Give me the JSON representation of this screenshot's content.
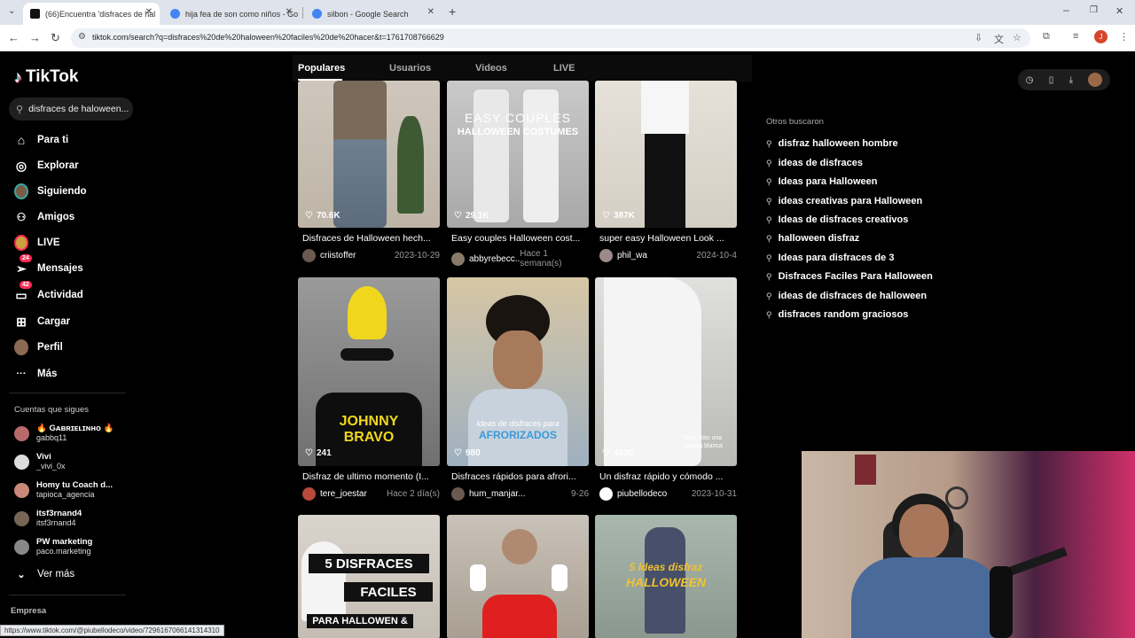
{
  "browser": {
    "tabs": [
      {
        "title": "(66)Encuentra 'disfraces de hal",
        "active": true,
        "favicon_color": "#111111"
      },
      {
        "title": "hija fea de son como niños - Go",
        "active": false,
        "favicon_color": "#4285f4"
      },
      {
        "title": "silbon - Google Search",
        "active": false,
        "favicon_color": "#4285f4"
      }
    ],
    "url": "tiktok.com/search?q=disfraces%20de%20haloween%20faciles%20de%20hacer&t=1761708766629",
    "profile_initial": "J",
    "status_url": "https://www.tiktok.com/@piubellodeco/video/7296167066141314310"
  },
  "tiktok": {
    "logo": "TikTok",
    "search_value": "disfraces de haloween...",
    "nav": [
      {
        "label": "Para ti",
        "icon": "home-icon",
        "glyph": "⌂"
      },
      {
        "label": "Explorar",
        "icon": "compass-icon",
        "glyph": "◎"
      },
      {
        "label": "Siguiendo",
        "icon": "following-avatar-icon",
        "glyph": ""
      },
      {
        "label": "Amigos",
        "icon": "friends-icon",
        "glyph": "👥"
      },
      {
        "label": "LIVE",
        "icon": "live-avatar-icon",
        "glyph": ""
      },
      {
        "label": "Mensajes",
        "icon": "messages-icon",
        "glyph": "✈",
        "badge": "24"
      },
      {
        "label": "Actividad",
        "icon": "activity-icon",
        "glyph": "▢",
        "badge": "42"
      },
      {
        "label": "Cargar",
        "icon": "upload-icon",
        "glyph": "⊞"
      },
      {
        "label": "Perfil",
        "icon": "profile-avatar-icon",
        "glyph": ""
      },
      {
        "label": "Más",
        "icon": "more-icon",
        "glyph": "···"
      }
    ],
    "following_title": "Cuentas que sigues",
    "following": [
      {
        "name": "🔥 Gᴀʙʀɪᴇʟɪɴʜᴏ 🔥",
        "handle": "gabbq11",
        "color": "#b86a6a"
      },
      {
        "name": "Vivi",
        "handle": "_vivi_0x",
        "color": "#ddd"
      },
      {
        "name": "Homy tu Coach d...",
        "handle": "tapioca_agencia",
        "color": "#c9887a"
      },
      {
        "name": "itsf3rnand4",
        "handle": "itsf3rnand4",
        "color": "#776655"
      },
      {
        "name": "PW marketing",
        "handle": "paco.marketing",
        "color": "#888"
      }
    ],
    "ver_mas": "Ver más",
    "empresa": "Empresa",
    "search_tabs": [
      "Populares",
      "Usuarios",
      "Videos",
      "LIVE"
    ],
    "videos": [
      {
        "likes": "70.6K",
        "title": "Disfraces de Halloween hech...",
        "author": "criistoffer",
        "date": "2023-10-29",
        "bg": "#cfc7bd"
      },
      {
        "likes": "29.1K",
        "title": "Easy couples Halloween cost...",
        "author": "abbyrebecc..",
        "date": "Hace 1 semana(s)",
        "bg": "#c9c9c9",
        "overlay1": "EASY COUPLES",
        "overlay2": "HALLOWEEN COSTUMES"
      },
      {
        "likes": "387K",
        "title": "super easy Halloween Look ...",
        "author": "phil_wa",
        "date": "2024-10-4",
        "bg": "#e2ddd5"
      },
      {
        "likes": "241",
        "title": "Disfraz de ultimo momento (I...",
        "author": "tere_joestar",
        "date": "Hace 2 día(s)",
        "bg": "#8a8a8a",
        "overlay1": "JOHNNY",
        "overlay2": "BRAVO"
      },
      {
        "likes": "980",
        "title": "Disfraces rápidos para afrori...",
        "author": "hum_manjar...",
        "date": "9-26",
        "bg": "#b7c2cc",
        "overlay1": "Ideas de disfraces para",
        "overlay2": "AFRORIZADOS"
      },
      {
        "likes": "4690",
        "title": "Un disfraz rápido y cómodo ...",
        "author": "piubellodeco",
        "date": "2023-10-31",
        "bg": "#d8d8d6",
        "overlay1": "Necesitas una",
        "overlay2": "sábana blanca"
      },
      {
        "likes": "",
        "title": "",
        "author": "",
        "date": "",
        "bg": "#d9d4cd",
        "overlay1": "5 DISFRACES",
        "overlay2": "FACILES"
      },
      {
        "likes": "",
        "title": "",
        "author": "",
        "date": "",
        "bg": "#c9c2b8"
      },
      {
        "likes": "",
        "title": "",
        "author": "",
        "date": "",
        "bg": "#9aa89f",
        "overlay1": "5 Ideas disfraz",
        "overlay2": "HALLOWEEN"
      }
    ],
    "others_title": "Otros buscaron",
    "others": [
      "disfraz halloween hombre",
      "ideas de disfraces",
      "Ideas para Halloween",
      "ideas creativas para Halloween",
      "Ideas de disfraces creativos",
      "halloween disfraz",
      "Ideas para disfraces de 3",
      "Disfraces Faciles Para Halloween",
      "ideas de disfraces de halloween",
      "disfraces random graciosos"
    ],
    "extra_overlay": "PARA HALLOWEN &"
  }
}
